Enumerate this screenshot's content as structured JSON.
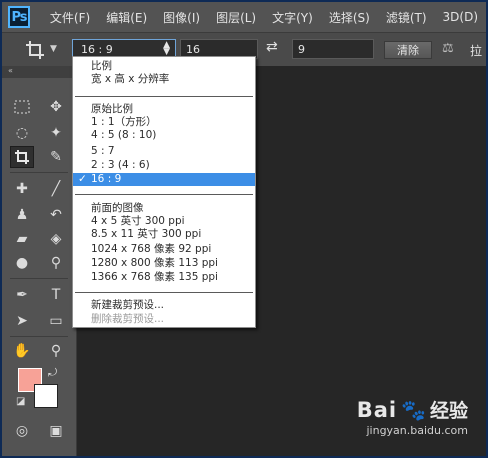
{
  "app": {
    "logo": "Ps"
  },
  "menu": [
    "文件(F)",
    "编辑(E)",
    "图像(I)",
    "图层(L)",
    "文字(Y)",
    "选择(S)",
    "滤镜(T)",
    "3D(D)"
  ],
  "options": {
    "ratio_value": "16 : 9",
    "width_value": "16",
    "height_value": "9",
    "clear_label": "清除",
    "straighten_label": "拉"
  },
  "dropdown": {
    "items": [
      {
        "label": "比例",
        "selected": false,
        "disabled": false
      },
      {
        "label": "宽 x 高 x 分辨率",
        "selected": false,
        "disabled": false
      },
      {
        "label": "原始比例",
        "selected": false,
        "disabled": false
      },
      {
        "label": "1 : 1（方形）",
        "selected": false,
        "disabled": false
      },
      {
        "label": "4 : 5 (8 : 10)",
        "selected": false,
        "disabled": false
      },
      {
        "label": "5 : 7",
        "selected": false,
        "disabled": false
      },
      {
        "label": "2 : 3 (4 : 6)",
        "selected": false,
        "disabled": false
      },
      {
        "label": "16 : 9",
        "selected": true,
        "disabled": false
      },
      {
        "label": "前面的图像",
        "selected": false,
        "disabled": false
      },
      {
        "label": "4 x 5 英寸 300 ppi",
        "selected": false,
        "disabled": false
      },
      {
        "label": "8.5 x 11 英寸 300 ppi",
        "selected": false,
        "disabled": false
      },
      {
        "label": "1024 x 768 像素 92 ppi",
        "selected": false,
        "disabled": false
      },
      {
        "label": "1280 x 800 像素 113 ppi",
        "selected": false,
        "disabled": false
      },
      {
        "label": "1366 x 768 像素 135 ppi",
        "selected": false,
        "disabled": false
      },
      {
        "label": "新建裁剪预设...",
        "selected": false,
        "disabled": false
      },
      {
        "label": "删除裁剪预设...",
        "selected": false,
        "disabled": true
      }
    ],
    "check_mark": "✓"
  },
  "colors": {
    "foreground": "#f7a297",
    "background": "#ffffff",
    "accent": "#3c8ee6"
  },
  "watermark": {
    "brand": "Bai",
    "brand2": "经验",
    "url": "jingyan.baidu.com"
  }
}
